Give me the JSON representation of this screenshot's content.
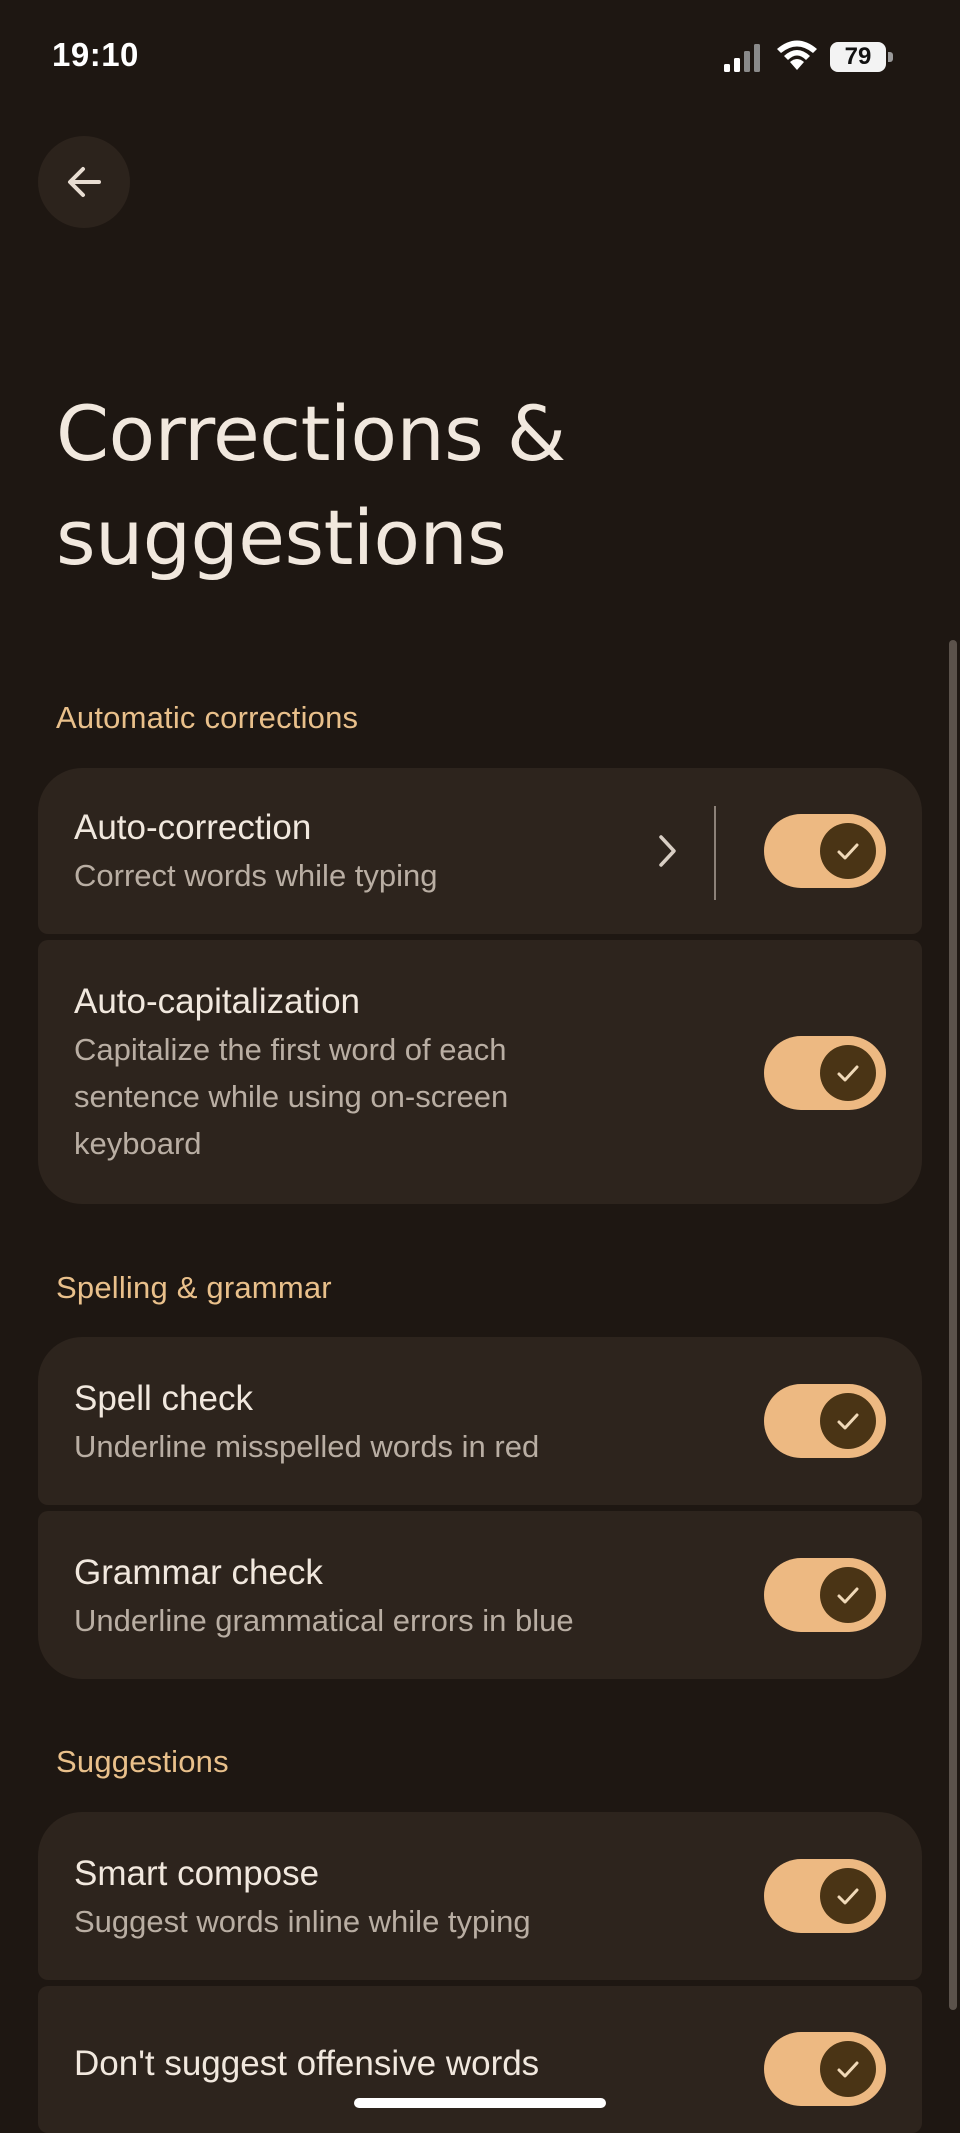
{
  "status_bar": {
    "time": "19:10",
    "battery": "79",
    "icons": [
      "signal-icon",
      "wifi-icon",
      "battery-icon"
    ]
  },
  "header": {
    "back_icon": "arrow-left-icon",
    "title": "Corrections & suggestions"
  },
  "colors": {
    "background": "#1e1712",
    "card": "#2d241d",
    "accent": "#e9c08b",
    "toggle_track": "#edb982",
    "toggle_knob": "#4a3415"
  },
  "sections": [
    {
      "header": "Automatic corrections",
      "items": [
        {
          "title": "Auto-correction",
          "subtitle": "Correct words while typing",
          "enabled": true,
          "has_detail": true
        },
        {
          "title": "Auto-capitalization",
          "subtitle": "Capitalize the first word of each sentence while using on-screen keyboard",
          "enabled": true
        }
      ]
    },
    {
      "header": "Spelling & grammar",
      "items": [
        {
          "title": "Spell check",
          "subtitle": "Underline misspelled words in red",
          "enabled": true
        },
        {
          "title": "Grammar check",
          "subtitle": "Underline grammatical errors in blue",
          "enabled": true
        }
      ]
    },
    {
      "header": "Suggestions",
      "items": [
        {
          "title": "Smart compose",
          "subtitle": "Suggest words inline while typing",
          "enabled": true
        },
        {
          "title": "Don't suggest offensive words",
          "enabled": true
        }
      ]
    }
  ]
}
